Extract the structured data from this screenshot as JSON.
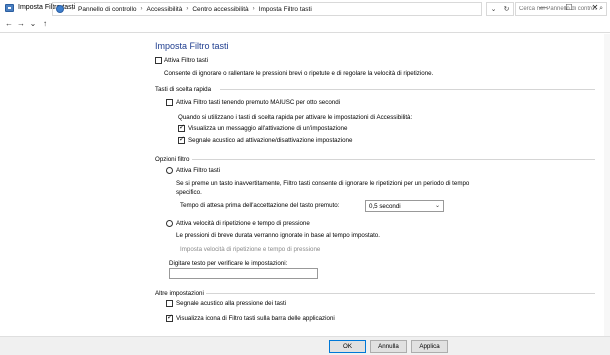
{
  "window": {
    "title": "Imposta Filtro tasti",
    "minimize": "—",
    "maximize": "☐",
    "close": "✕"
  },
  "nav": {
    "back": "←",
    "forward": "→",
    "recent": "⌄",
    "up": "↑"
  },
  "breadcrumb": [
    "Pannello di controllo",
    "Accessibilità",
    "Centro accessibilità",
    "Imposta Filtro tasti"
  ],
  "search": {
    "placeholder": "Cerca nel Pannello di contro...",
    "value": ""
  },
  "refresh": {
    "dropdown": "⌄",
    "reload": "↻"
  },
  "page": {
    "title": "Imposta Filtro tasti",
    "enable_label": "Attiva Filtro tasti",
    "enable_checked": false,
    "enable_desc": "Consente di ignorare o rallentare le pressioni brevi o ripetute e di regolare la velocità di ripetizione."
  },
  "shortcuts": {
    "heading": "Tasti di scelta rapida",
    "shift_label": "Attiva Filtro tasti tenendo premuto MAIUSC per otto secondi",
    "shift_checked": false,
    "note": "Quando si utilizzano i tasti di scelta rapida per attivare le impostazioni di Accessibilità:",
    "warn_label": "Visualizza un messaggio all'attivazione di un'impostazione",
    "warn_checked": true,
    "sound_label": "Segnale acustico ad attivazione/disattivazione impostazione",
    "sound_checked": true
  },
  "filter_options": {
    "heading": "Opzioni filtro",
    "bounce_label": "Attiva Filtro tasti",
    "bounce_desc": "Se si preme un tasto inavvertitamente, Filtro tasti consente di ignorare le ripetizioni per un periodo di tempo specifico.",
    "wait_label": "Tempo di attesa prima dell'accettazione del tasto premuto:",
    "wait_value": "0,5 secondi",
    "repeat_label": "Attiva velocità di ripetizione e tempo di pressione",
    "repeat_desc": "Le pressioni di breve durata verranno ignorate in base al tempo impostato.",
    "repeat_link": "Imposta velocità di ripetizione e tempo di pressione",
    "test_label": "Digitare testo per verificare le impostazioni:",
    "test_value": ""
  },
  "other": {
    "heading": "Altre impostazioni",
    "beep_label": "Segnale acustico alla pressione dei tasti",
    "beep_checked": false,
    "icon_label": "Visualizza icona di Filtro tasti sulla barra delle applicazioni",
    "icon_checked": true
  },
  "buttons": {
    "ok": "OK",
    "cancel": "Annulla",
    "apply": "Applica"
  },
  "icons": {
    "search": "search-icon",
    "chevron": "chevron-down-icon"
  },
  "colors": {
    "title": "#1e3d8f",
    "accent": "#0078d7"
  }
}
